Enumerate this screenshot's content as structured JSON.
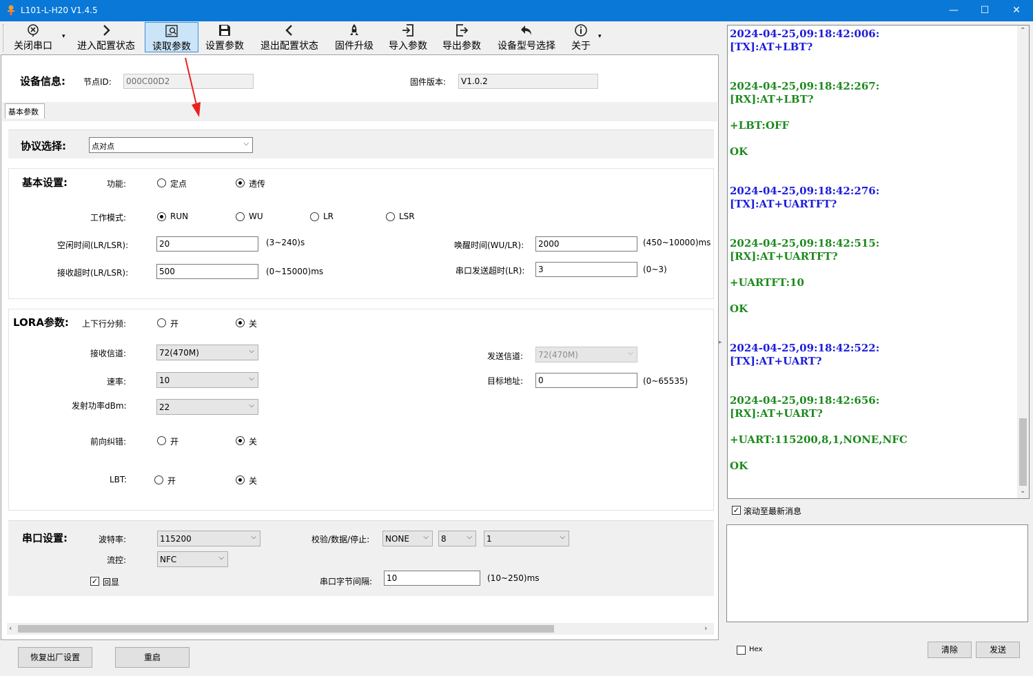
{
  "window": {
    "title": "L101-L-H20 V1.4.5",
    "minimize": "—",
    "maximize": "☐",
    "close": "✕"
  },
  "toolbar": {
    "items": [
      {
        "label": "关闭串口",
        "icon": "close-port-icon"
      },
      {
        "label": "进入配置状态",
        "icon": "chevron-right-icon"
      },
      {
        "label": "读取参数",
        "icon": "read-params-icon"
      },
      {
        "label": "设置参数",
        "icon": "save-icon"
      },
      {
        "label": "退出配置状态",
        "icon": "chevron-left-icon"
      },
      {
        "label": "固件升级",
        "icon": "rocket-icon"
      },
      {
        "label": "导入参数",
        "icon": "import-icon"
      },
      {
        "label": "导出参数",
        "icon": "export-icon"
      },
      {
        "label": "设备型号选择",
        "icon": "undo-arrow-icon"
      },
      {
        "label": "关于",
        "icon": "info-icon"
      }
    ],
    "active_item": "读取参数"
  },
  "device_info": {
    "header": "设备信息:",
    "node_id_label": "节点ID:",
    "node_id": "000C00D2",
    "firmware_label": "固件版本:",
    "firmware": "V1.0.2"
  },
  "tab": {
    "label": "基本参数"
  },
  "protocol": {
    "header": "协议选择:",
    "value": "点对点"
  },
  "basic": {
    "header": "基本设置:",
    "function_label": "功能:",
    "function_opts": [
      "定点",
      "透传"
    ],
    "function_selected": "透传",
    "mode_label": "工作模式:",
    "mode_opts": [
      "RUN",
      "WU",
      "LR",
      "LSR"
    ],
    "mode_selected": "RUN",
    "idle_label": "空闲时间(LR/LSR):",
    "idle_value": "20",
    "idle_range": "(3~240)s",
    "wake_label": "唤醒时间(WU/LR):",
    "wake_value": "2000",
    "wake_range": "(450~10000)ms",
    "rxto_label": "接收超时(LR/LSR):",
    "rxto_value": "500",
    "rxto_range": "(0~15000)ms",
    "uartto_label": "串口发送超时(LR):",
    "uartto_value": "3",
    "uartto_range": "(0~3)"
  },
  "lora": {
    "header": "LORA参数:",
    "split_label": "上下行分频:",
    "on": "开",
    "off": "关",
    "split_selected": "关",
    "rxch_label": "接收信道:",
    "rxch_value": "72(470M)",
    "txch_label": "发送信道:",
    "txch_value": "72(470M)",
    "rate_label": "速率:",
    "rate_value": "10",
    "target_label": "目标地址:",
    "target_value": "0",
    "target_range": "(0~65535)",
    "power_label": "发射功率dBm:",
    "power_value": "22",
    "fec_label": "前向纠错:",
    "fec_selected": "关",
    "lbt_label": "LBT:",
    "lbt_selected": "关"
  },
  "serial": {
    "header": "串口设置:",
    "baud_label": "波特率:",
    "baud_value": "115200",
    "parity_label": "校验/数据/停止:",
    "parity_value": "NONE",
    "data_value": "8",
    "stop_value": "1",
    "flow_label": "流控:",
    "flow_value": "NFC",
    "echo_label": "回显",
    "echo_checked": true,
    "gap_label": "串口字节间隔:",
    "gap_value": "10",
    "gap_range": "(10~250)ms"
  },
  "bottom_buttons": {
    "factory_reset": "恢复出厂设置",
    "restart": "重启"
  },
  "log": [
    {
      "text": "2024-04-25,09:18:42:006:",
      "kind": "tx"
    },
    {
      "text": "[TX]:AT+LBT?",
      "kind": "tx"
    },
    {
      "text": "2024-04-25,09:18:42:267:",
      "kind": "rx"
    },
    {
      "text": "[RX]:AT+LBT?",
      "kind": "rx"
    },
    {
      "text": "+LBT:OFF",
      "kind": "rx"
    },
    {
      "text": "OK",
      "kind": "rx"
    },
    {
      "text": "2024-04-25,09:18:42:276:",
      "kind": "tx"
    },
    {
      "text": "[TX]:AT+UARTFT?",
      "kind": "tx"
    },
    {
      "text": "2024-04-25,09:18:42:515:",
      "kind": "rx"
    },
    {
      "text": "[RX]:AT+UARTFT?",
      "kind": "rx"
    },
    {
      "text": "+UARTFT:10",
      "kind": "rx"
    },
    {
      "text": "OK",
      "kind": "rx"
    },
    {
      "text": "2024-04-25,09:18:42:522:",
      "kind": "tx"
    },
    {
      "text": "[TX]:AT+UART?",
      "kind": "tx"
    },
    {
      "text": "2024-04-25,09:18:42:656:",
      "kind": "rx"
    },
    {
      "text": "[RX]:AT+UART?",
      "kind": "rx"
    },
    {
      "text": "+UART:115200,8,1,NONE,NFC",
      "kind": "rx"
    },
    {
      "text": "OK",
      "kind": "rx"
    }
  ],
  "right_panel": {
    "autoscroll_label": "滚动至最新消息",
    "autoscroll_checked": true,
    "hex_label": "Hex",
    "hex_checked": false,
    "clear_button": "清除",
    "send_button": "发送"
  },
  "colors": {
    "titlebar": "#0a78d7",
    "tx_text": "#1c1cdc",
    "rx_text": "#1d8a1d",
    "annotation_arrow": "#e8211d"
  }
}
